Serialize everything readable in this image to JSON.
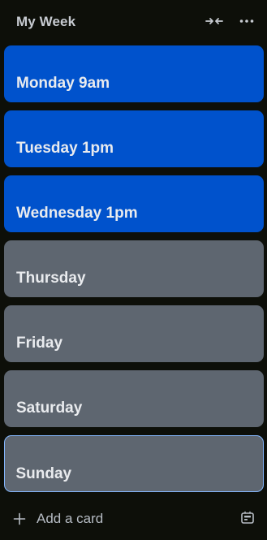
{
  "list": {
    "title": "My Week"
  },
  "header": {
    "collapse_icon": "collapse-horizontal-icon",
    "more_icon": "more-horizontal-icon"
  },
  "cards": [
    {
      "title": "Monday 9am",
      "color": "#0052cc"
    },
    {
      "title": "Tuesday 1pm",
      "color": "#0052cc"
    },
    {
      "title": "Wednesday 1pm",
      "color": "#0052cc"
    },
    {
      "title": "Thursday",
      "color": "#5e6670"
    },
    {
      "title": "Friday",
      "color": "#5e6670"
    },
    {
      "title": "Saturday",
      "color": "#5e6670"
    },
    {
      "title": "Sunday",
      "color": "#5e6670",
      "selected": true
    }
  ],
  "footer": {
    "add_label": "Add a card",
    "add_icon": "plus-icon",
    "template_icon": "card-template-icon"
  },
  "colors": {
    "background": "#0d0f09",
    "selection_outline": "#85b8ff"
  }
}
